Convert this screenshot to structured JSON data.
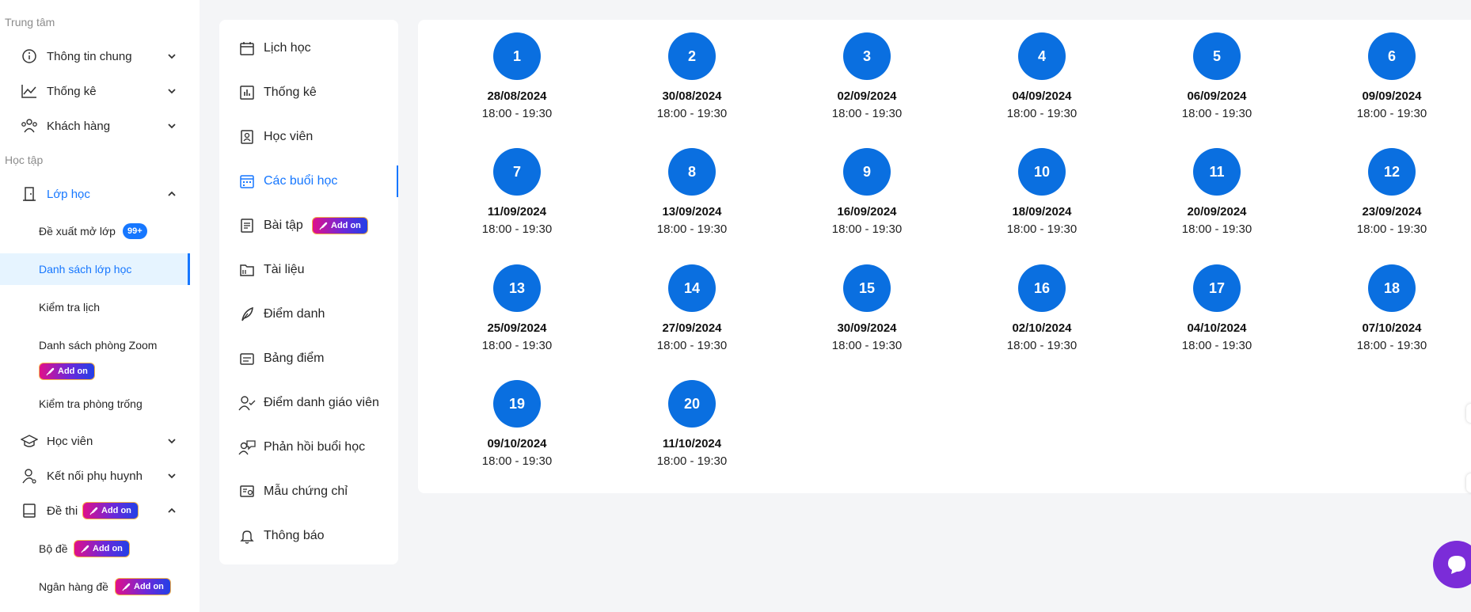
{
  "sidebar": {
    "section_center": "Trung tâm",
    "section_study": "Học tập",
    "general_info": "Thông tin chung",
    "statistics": "Thống kê",
    "customers": "Khách hàng",
    "classes": "Lớp học",
    "class_proposal": "Đề xuất mở lớp",
    "class_proposal_badge": "99+",
    "class_list": "Danh sách lớp học",
    "schedule_check": "Kiểm tra lịch",
    "zoom_rooms": "Danh sách phòng Zoom",
    "empty_room_check": "Kiểm tra phòng trống",
    "students": "Học viên",
    "parents": "Kết nối phụ huynh",
    "exams": "Đề thi",
    "exam_sets": "Bộ đề",
    "exam_bank": "Ngân hàng đề",
    "addon_label": "Add on"
  },
  "menu": {
    "items": [
      {
        "label": "Lịch học",
        "icon": "calendar-icon"
      },
      {
        "label": "Thống kê",
        "icon": "bar-chart-icon"
      },
      {
        "label": "Học viên",
        "icon": "student-card-icon"
      },
      {
        "label": "Các buổi học",
        "icon": "calendar-sessions-icon"
      },
      {
        "label": "Bài tập",
        "icon": "assignment-icon"
      },
      {
        "label": "Tài liệu",
        "icon": "folder-icon"
      },
      {
        "label": "Điểm danh",
        "icon": "feather-icon"
      },
      {
        "label": "Bảng điểm",
        "icon": "scoreboard-icon"
      },
      {
        "label": "Điểm danh giáo viên",
        "icon": "user-check-icon"
      },
      {
        "label": "Phản hồi buổi học",
        "icon": "feedback-icon"
      },
      {
        "label": "Mẫu chứng chỉ",
        "icon": "certificate-icon"
      },
      {
        "label": "Thông báo",
        "icon": "bell-icon"
      }
    ],
    "active_index": 3,
    "addon_label": "Add on"
  },
  "sessions": [
    {
      "number": "1",
      "date": "28/08/2024",
      "time": "18:00 - 19:30"
    },
    {
      "number": "2",
      "date": "30/08/2024",
      "time": "18:00 - 19:30"
    },
    {
      "number": "3",
      "date": "02/09/2024",
      "time": "18:00 - 19:30"
    },
    {
      "number": "4",
      "date": "04/09/2024",
      "time": "18:00 - 19:30"
    },
    {
      "number": "5",
      "date": "06/09/2024",
      "time": "18:00 - 19:30"
    },
    {
      "number": "6",
      "date": "09/09/2024",
      "time": "18:00 - 19:30"
    },
    {
      "number": "7",
      "date": "11/09/2024",
      "time": "18:00 - 19:30"
    },
    {
      "number": "8",
      "date": "13/09/2024",
      "time": "18:00 - 19:30"
    },
    {
      "number": "9",
      "date": "16/09/2024",
      "time": "18:00 - 19:30"
    },
    {
      "number": "10",
      "date": "18/09/2024",
      "time": "18:00 - 19:30"
    },
    {
      "number": "11",
      "date": "20/09/2024",
      "time": "18:00 - 19:30"
    },
    {
      "number": "12",
      "date": "23/09/2024",
      "time": "18:00 - 19:30"
    },
    {
      "number": "13",
      "date": "25/09/2024",
      "time": "18:00 - 19:30"
    },
    {
      "number": "14",
      "date": "27/09/2024",
      "time": "18:00 - 19:30"
    },
    {
      "number": "15",
      "date": "30/09/2024",
      "time": "18:00 - 19:30"
    },
    {
      "number": "16",
      "date": "02/10/2024",
      "time": "18:00 - 19:30"
    },
    {
      "number": "17",
      "date": "04/10/2024",
      "time": "18:00 - 19:30"
    },
    {
      "number": "18",
      "date": "07/10/2024",
      "time": "18:00 - 19:30"
    },
    {
      "number": "19",
      "date": "09/10/2024",
      "time": "18:00 - 19:30"
    },
    {
      "number": "20",
      "date": "11/10/2024",
      "time": "18:00 - 19:30"
    }
  ],
  "colors": {
    "accent": "#1677ff",
    "session_circle": "#0a6fe0",
    "chat": "#7b2cd8"
  }
}
